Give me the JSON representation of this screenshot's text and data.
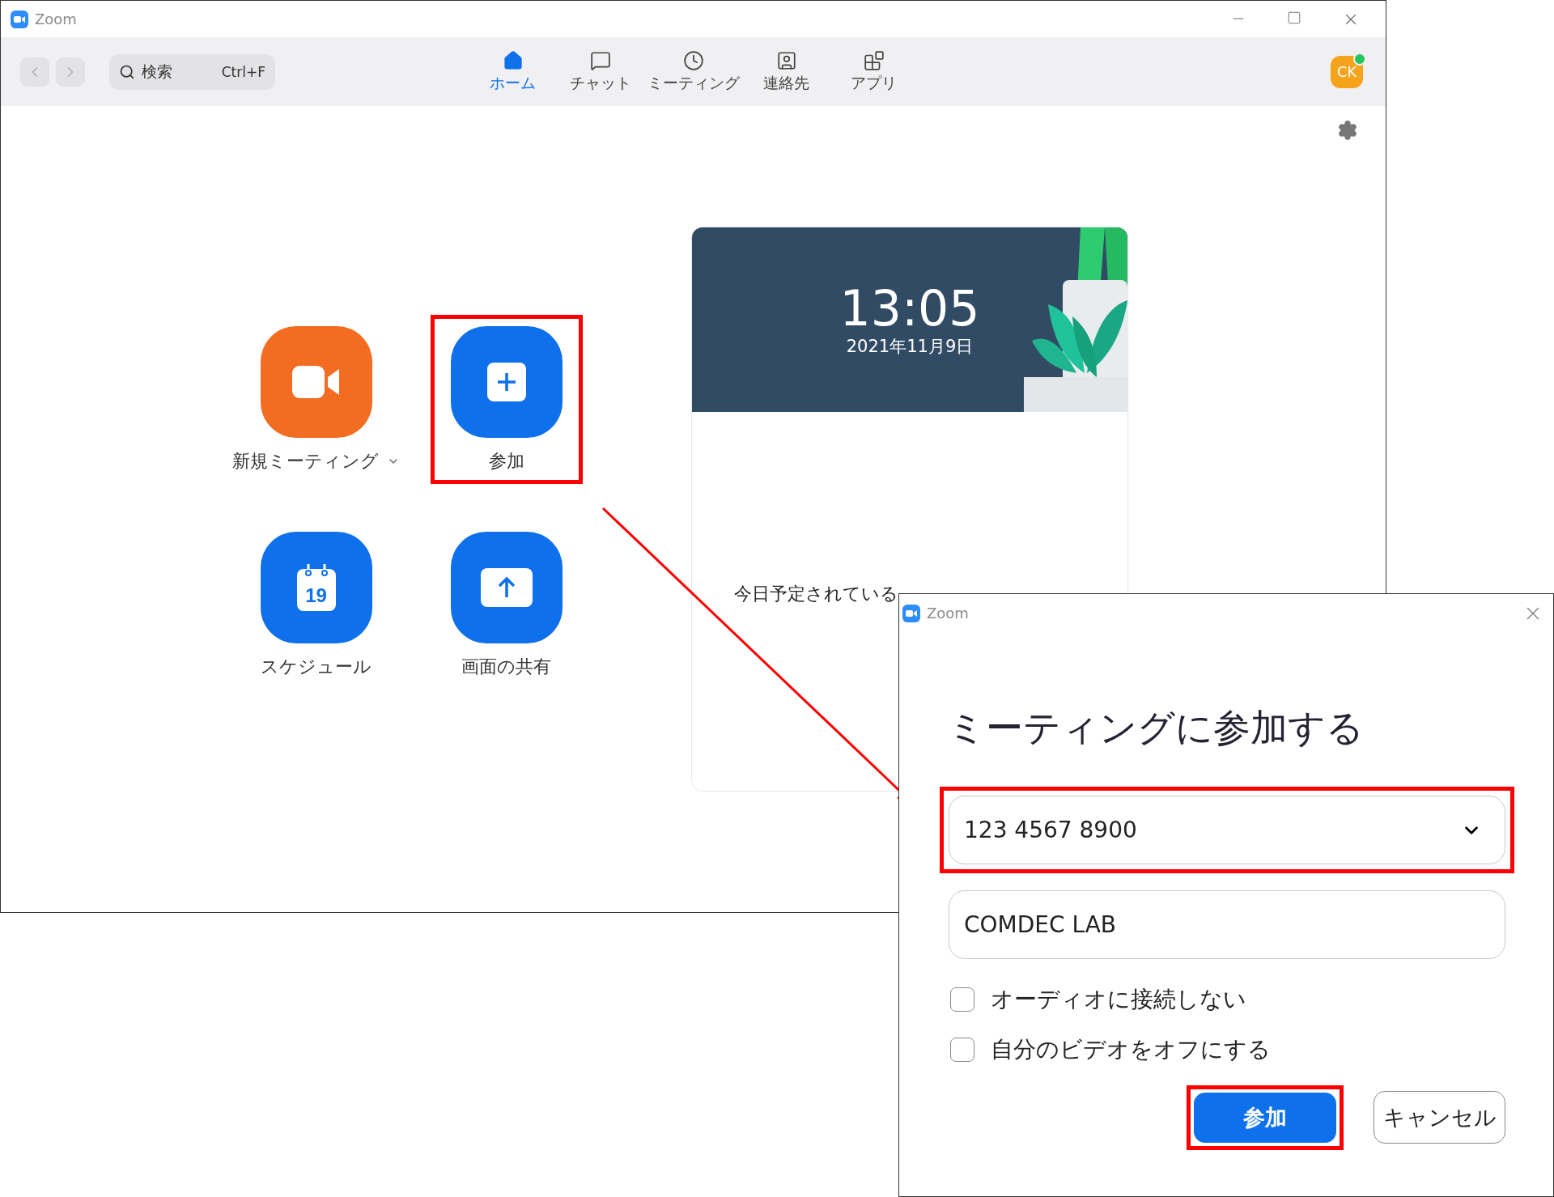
{
  "main_window": {
    "title": "Zoom",
    "search": {
      "placeholder": "検索",
      "shortcut": "Ctrl+F"
    },
    "tabs": [
      {
        "label": "ホーム",
        "selected": true
      },
      {
        "label": "チャット",
        "selected": false
      },
      {
        "label": "ミーティング",
        "selected": false
      },
      {
        "label": "連絡先",
        "selected": false
      },
      {
        "label": "アプリ",
        "selected": false
      }
    ],
    "avatar": {
      "initials": "CK",
      "online": true
    },
    "actions": [
      {
        "label": "新規ミーティング",
        "color": "#f26d21",
        "has_menu": true,
        "highlighted": false
      },
      {
        "label": "参加",
        "color": "#0e71eb",
        "has_menu": false,
        "highlighted": true
      },
      {
        "label": "スケジュール",
        "color": "#0e71eb",
        "has_menu": false,
        "highlighted": false,
        "badge": "19"
      },
      {
        "label": "画面の共有",
        "color": "#0e71eb",
        "has_menu": false,
        "highlighted": false
      }
    ],
    "card": {
      "time": "13:05",
      "date": "2021年11月9日",
      "message": "今日予定されている"
    }
  },
  "dialog": {
    "title": "Zoom",
    "heading": "ミーティングに参加する",
    "meeting_id": {
      "value": "123 4567 8900",
      "highlighted": true
    },
    "name_field": {
      "value": "COMDEC LAB",
      "highlighted": false
    },
    "options": [
      {
        "label": "オーディオに接続しない",
        "checked": false
      },
      {
        "label": "自分のビデオをオフにする",
        "checked": false
      }
    ],
    "buttons": [
      {
        "label": "参加",
        "kind": "primary",
        "highlighted": true
      },
      {
        "label": "キャンセル",
        "kind": "secondary",
        "highlighted": false
      }
    ]
  }
}
